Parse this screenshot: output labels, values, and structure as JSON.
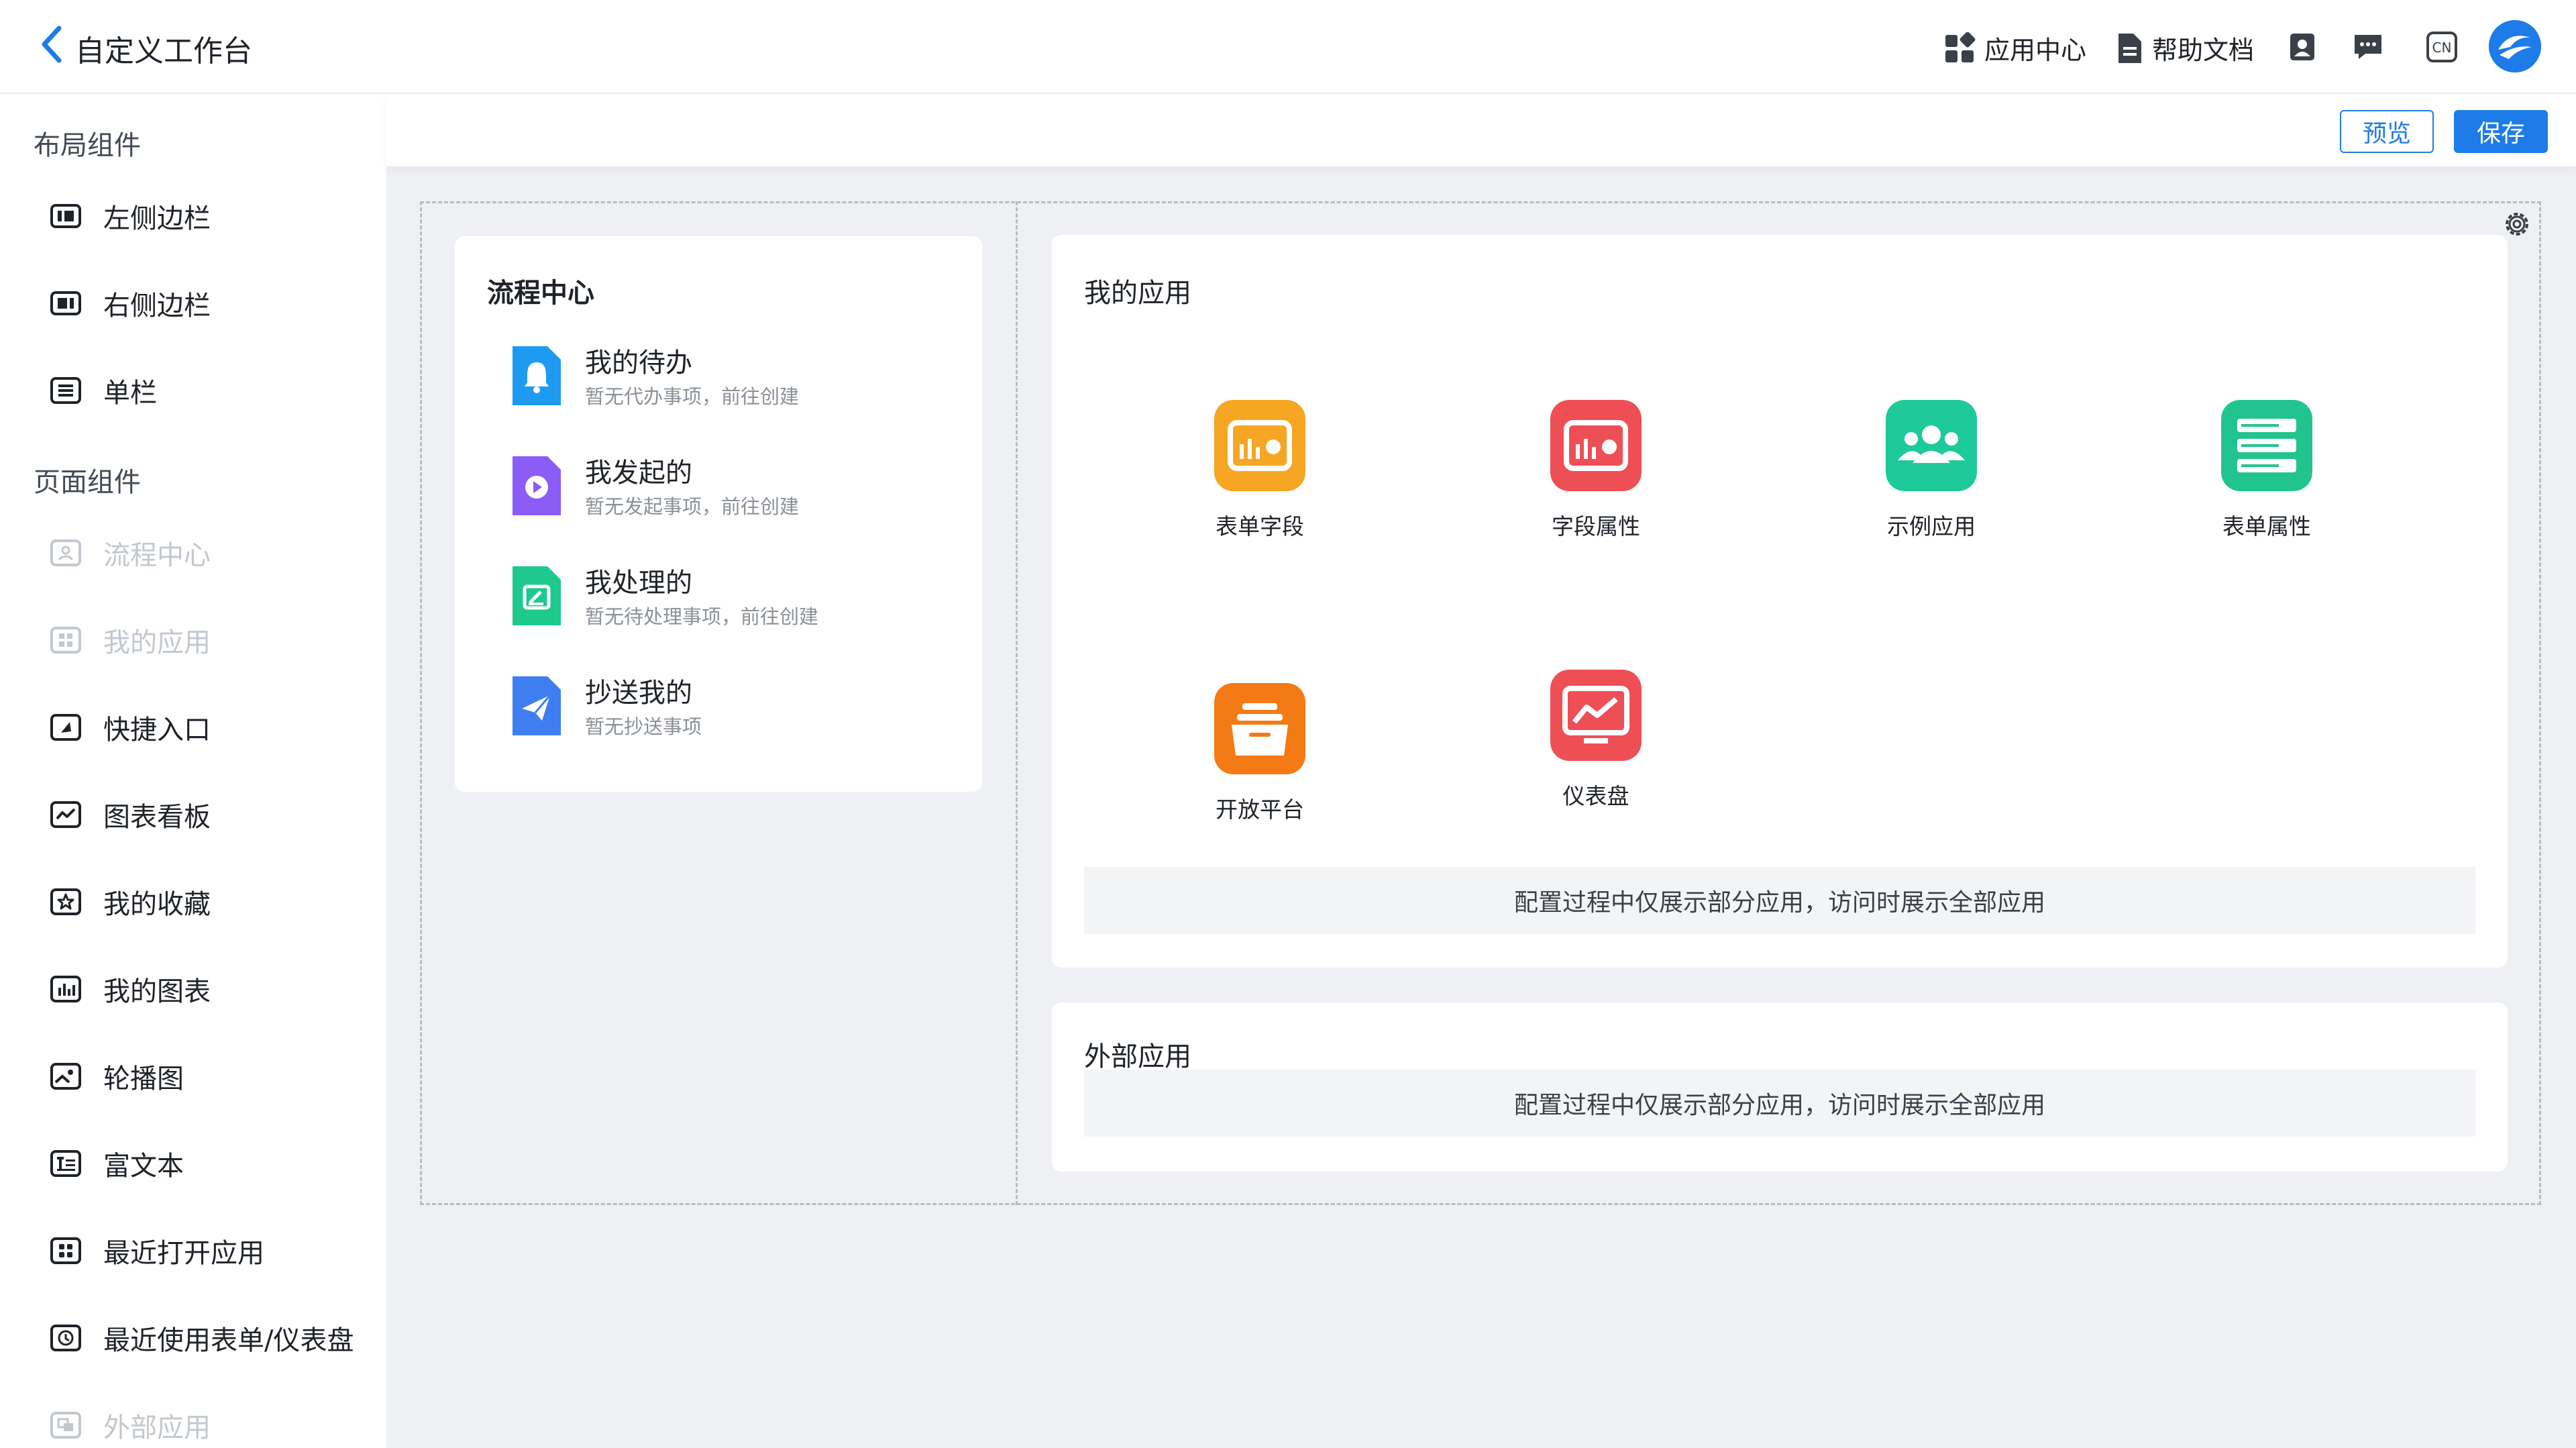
{
  "header": {
    "title": "自定义工作台",
    "nav": [
      {
        "label": "应用中心",
        "icon": "grid-icon"
      },
      {
        "label": "帮助文档",
        "icon": "document-icon"
      }
    ],
    "icons": [
      "contacts-icon",
      "chat-icon",
      "language-icon",
      "logo-icon"
    ],
    "lang_badge": "CN"
  },
  "toolbar": {
    "preview_label": "预览",
    "save_label": "保存"
  },
  "sidebar": {
    "layout_title": "布局组件",
    "layout_items": [
      {
        "label": "左侧边栏",
        "icon": "left-sidebar-icon"
      },
      {
        "label": "右侧边栏",
        "icon": "right-sidebar-icon"
      },
      {
        "label": "单栏",
        "icon": "single-column-icon"
      }
    ],
    "page_title": "页面组件",
    "page_items": [
      {
        "label": "流程中心",
        "icon": "flow-center-icon",
        "disabled": true
      },
      {
        "label": "我的应用",
        "icon": "my-apps-icon",
        "disabled": true
      },
      {
        "label": "快捷入口",
        "icon": "shortcut-icon",
        "disabled": false
      },
      {
        "label": "图表看板",
        "icon": "chart-board-icon",
        "disabled": false
      },
      {
        "label": "我的收藏",
        "icon": "favorite-icon",
        "disabled": false
      },
      {
        "label": "我的图表",
        "icon": "bar-chart-icon",
        "disabled": false
      },
      {
        "label": "轮播图",
        "icon": "carousel-icon",
        "disabled": false
      },
      {
        "label": "富文本",
        "icon": "rich-text-icon",
        "disabled": false
      },
      {
        "label": "最近打开应用",
        "icon": "recent-apps-icon",
        "disabled": false
      },
      {
        "label": "最近使用表单/仪表盘",
        "icon": "clock-icon",
        "disabled": false
      },
      {
        "label": "外部应用",
        "icon": "external-app-icon",
        "disabled": true
      }
    ]
  },
  "flow_center": {
    "title": "流程中心",
    "items": [
      {
        "name": "我的待办",
        "desc": "暂无代办事项，前往创建",
        "color": "#1e9bf0",
        "icon": "bell-icon"
      },
      {
        "name": "我发起的",
        "desc": "暂无发起事项，前往创建",
        "color": "#8b5cf6",
        "icon": "play-icon"
      },
      {
        "name": "我处理的",
        "desc": "暂无待处理事项，前往创建",
        "color": "#1ec98e",
        "icon": "edit-icon"
      },
      {
        "name": "抄送我的",
        "desc": "暂无抄送事项",
        "color": "#3f7ef0",
        "icon": "send-icon"
      }
    ]
  },
  "my_apps": {
    "title": "我的应用",
    "apps": [
      {
        "name": "表单字段",
        "color": "#f6a623",
        "icon": "form-field-icon"
      },
      {
        "name": "字段属性",
        "color": "#ee4f55",
        "icon": "field-property-icon"
      },
      {
        "name": "示例应用",
        "color": "#1ec99a",
        "icon": "people-icon"
      },
      {
        "name": "表单属性",
        "color": "#21c48f",
        "icon": "list-icon"
      },
      {
        "name": "开放平台",
        "color": "#f47a14",
        "icon": "box-icon"
      },
      {
        "name": "仪表盘",
        "color": "#ee4f55",
        "icon": "dashboard-icon"
      }
    ],
    "notice": "配置过程中仅展示部分应用，访问时展示全部应用"
  },
  "external_apps": {
    "title": "外部应用",
    "notice": "配置过程中仅展示部分应用，访问时展示全部应用"
  }
}
